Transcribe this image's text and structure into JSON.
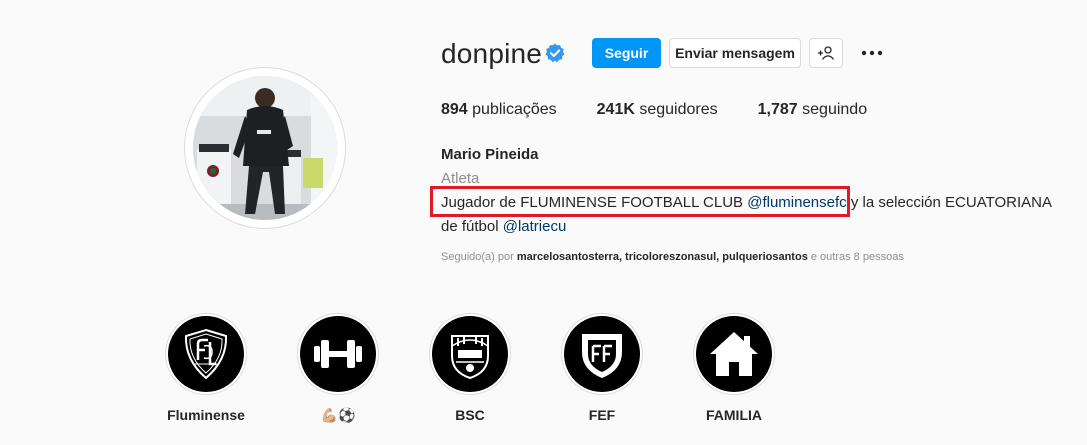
{
  "profile": {
    "username": "donpine",
    "follow_label": "Seguir",
    "message_label": "Enviar mensagem",
    "more_icon": "more-dots-icon",
    "stats": [
      {
        "count": "894",
        "label": "publicações"
      },
      {
        "count": "241K",
        "label": "seguidores"
      },
      {
        "count": "1,787",
        "label": "seguindo"
      }
    ],
    "full_name": "Mario Pineida",
    "category": "Atleta",
    "bio": {
      "line1_prefix": "Jugador de FLUMINENSE FOOTBALL CLUB ",
      "mention1": "@fluminensefc",
      "line1_suffix": " y la selección ECUATORIANA",
      "line2_prefix": "de fútbol ",
      "mention2": "@latriecu"
    },
    "followed_by": {
      "prefix": "Seguido(a) por",
      "users": "marcelosantosterra, tricoloreszonasul, pulqueriosantos",
      "suffix": "e outras 8 pessoas"
    }
  },
  "highlights": [
    {
      "label": "Fluminense",
      "icon": "fluminense-crest-icon"
    },
    {
      "label": "💪🏼⚽",
      "icon": "dumbbell-icon"
    },
    {
      "label": "BSC",
      "icon": "bsc-crest-icon"
    },
    {
      "label": "FEF",
      "icon": "fef-crest-icon"
    },
    {
      "label": "FAMILIA",
      "icon": "house-icon"
    }
  ],
  "colors": {
    "accent": "#0095f6",
    "verified": "#3897f0",
    "link": "#00376b",
    "annotation": "#e11a27"
  }
}
